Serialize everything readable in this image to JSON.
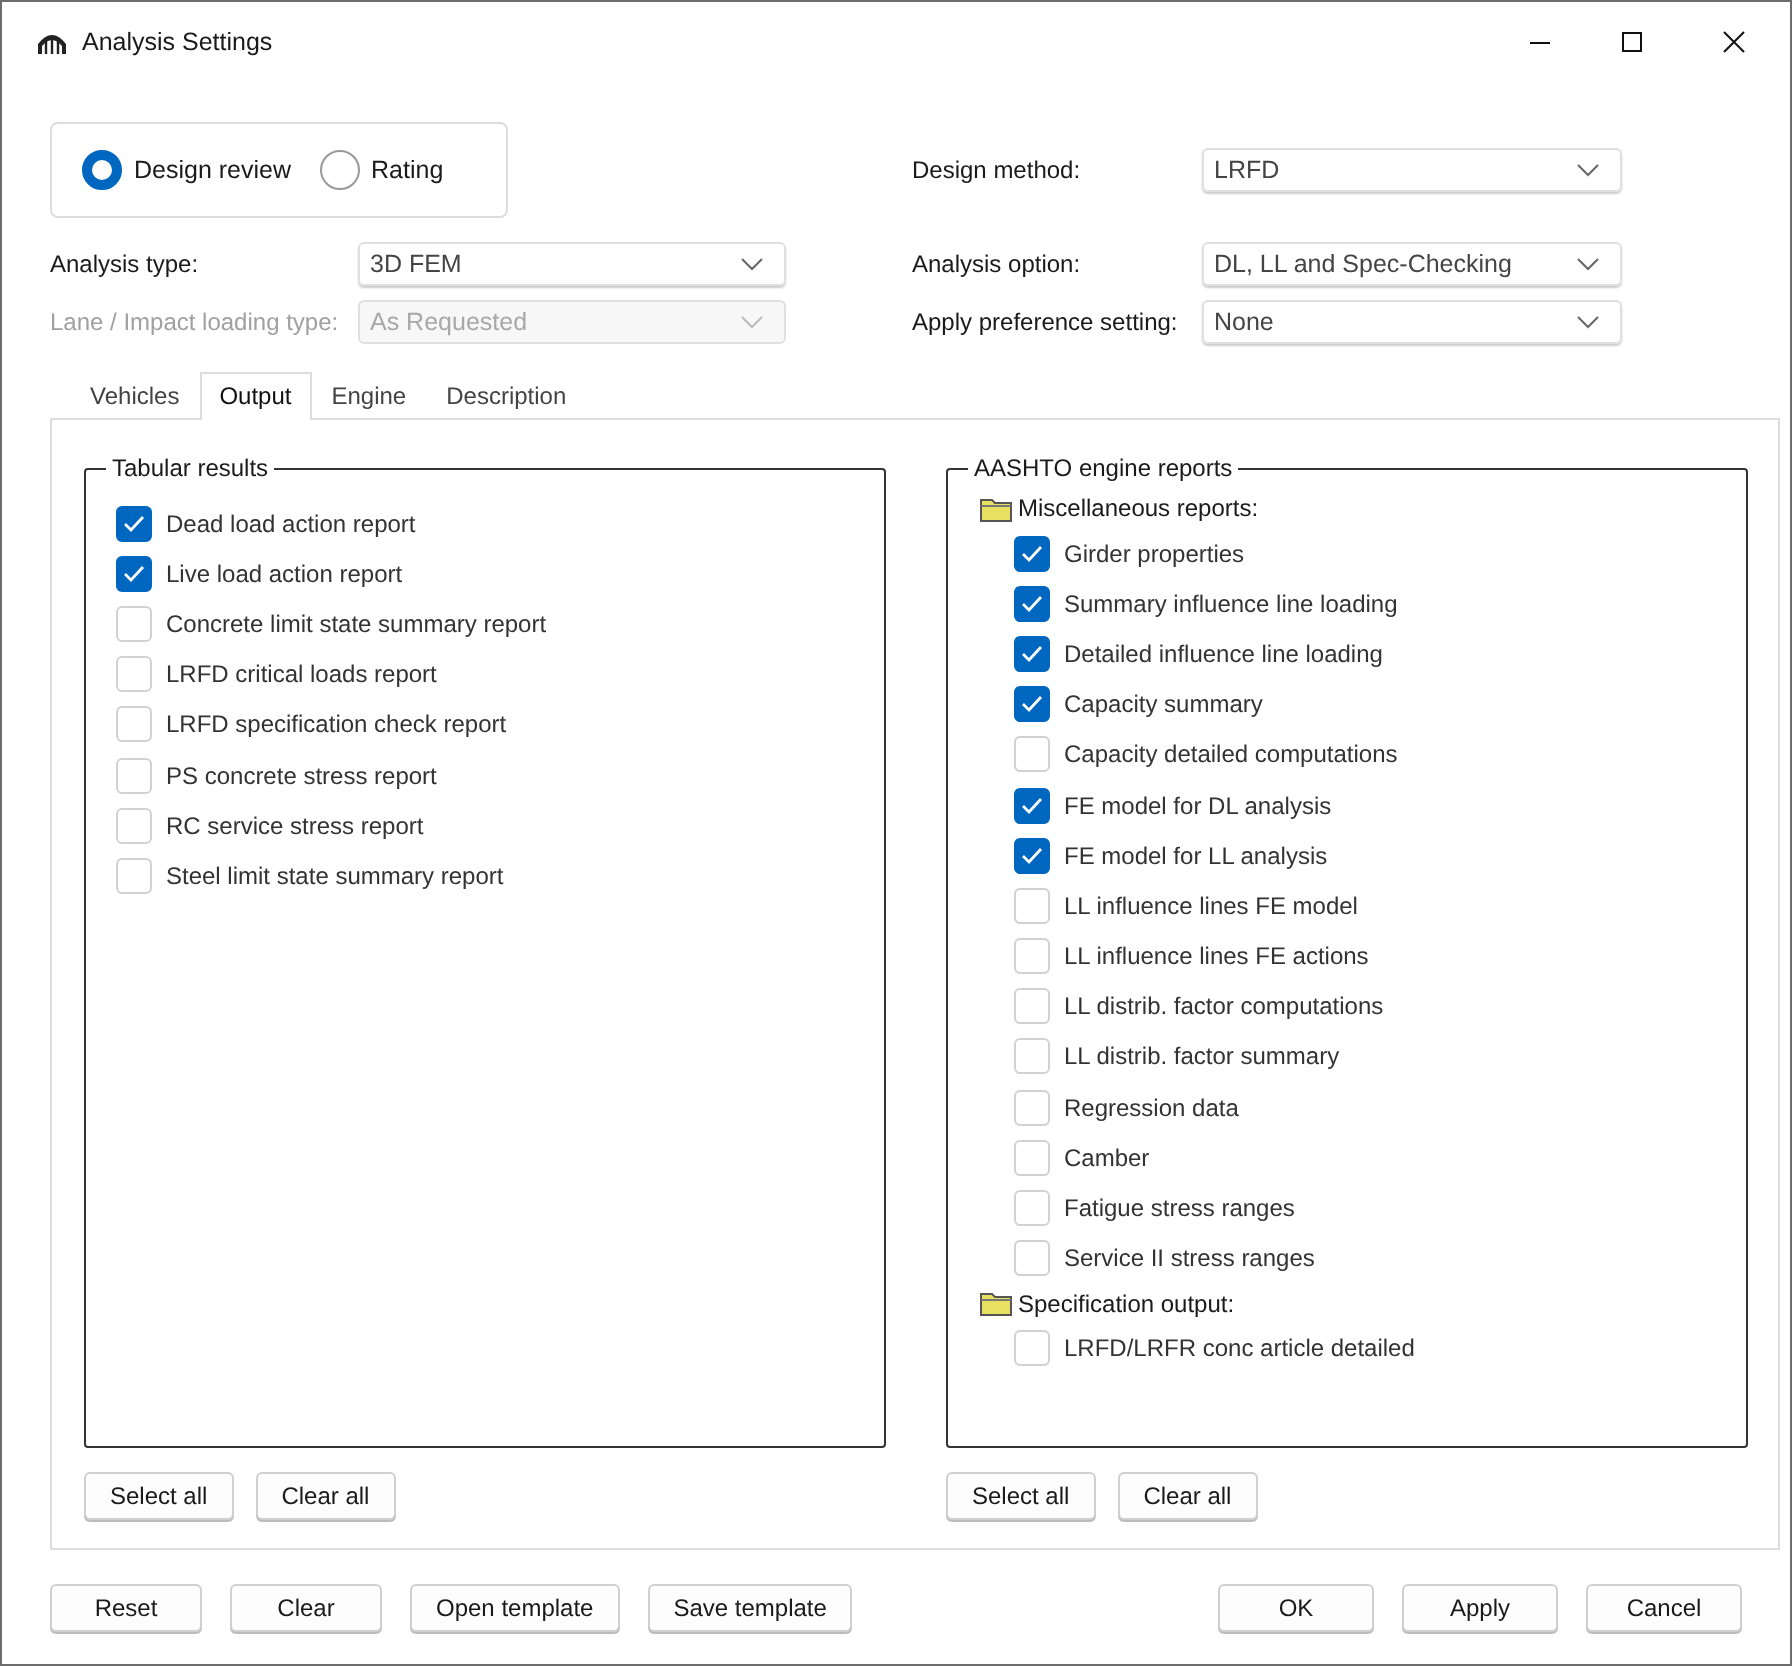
{
  "window": {
    "title": "Analysis Settings"
  },
  "mode": [
    {
      "label": "Design review",
      "selected": true
    },
    {
      "label": "Rating",
      "selected": false
    }
  ],
  "left_fields": [
    {
      "label": "Analysis type:",
      "value": "3D FEM",
      "disabled": false
    },
    {
      "label": "Lane / Impact loading type:",
      "value": "As Requested",
      "disabled": true
    }
  ],
  "design_method": {
    "label": "Design method:",
    "value": "LRFD",
    "disabled": false
  },
  "right_fields": [
    {
      "label": "Analysis option:",
      "value": "DL, LL and Spec-Checking",
      "disabled": false
    },
    {
      "label": "Apply preference setting:",
      "value": "None",
      "disabled": false
    }
  ],
  "tabs": [
    {
      "label": "Vehicles",
      "selected": false
    },
    {
      "label": "Output",
      "selected": true
    },
    {
      "label": "Engine",
      "selected": false
    },
    {
      "label": "Description",
      "selected": false
    }
  ],
  "tabular_results": {
    "title": "Tabular results",
    "items": [
      {
        "label": "Dead load action report",
        "checked": true
      },
      {
        "label": "Live load action report",
        "checked": true
      },
      {
        "label": "Concrete limit state summary report",
        "checked": false
      },
      {
        "label": "LRFD critical loads report",
        "checked": false
      },
      {
        "label": "LRFD specification check report",
        "checked": false
      },
      {
        "label": "PS concrete stress report",
        "checked": false
      },
      {
        "label": "RC service stress report",
        "checked": false
      },
      {
        "label": "Steel limit state summary report",
        "checked": false
      }
    ],
    "buttons": [
      "Select all",
      "Clear all"
    ]
  },
  "engine_reports": {
    "title": "AASHTO engine reports",
    "groups": [
      {
        "label": "Miscellaneous reports:",
        "items": [
          {
            "label": "Girder properties",
            "checked": true
          },
          {
            "label": "Summary influence line loading",
            "checked": true
          },
          {
            "label": "Detailed influence line loading",
            "checked": true
          },
          {
            "label": "Capacity summary",
            "checked": true
          },
          {
            "label": "Capacity detailed computations",
            "checked": false
          },
          {
            "label": "FE model for DL analysis",
            "checked": true
          },
          {
            "label": "FE model for LL analysis",
            "checked": true
          },
          {
            "label": "LL influence lines FE model",
            "checked": false
          },
          {
            "label": "LL influence lines FE actions",
            "checked": false
          },
          {
            "label": "LL distrib. factor computations",
            "checked": false
          },
          {
            "label": "LL distrib. factor summary",
            "checked": false
          },
          {
            "label": "Regression data",
            "checked": false
          },
          {
            "label": "Camber",
            "checked": false
          },
          {
            "label": "Fatigue stress ranges",
            "checked": false
          },
          {
            "label": "Service II stress ranges",
            "checked": false
          }
        ]
      },
      {
        "label": "Specification output:",
        "items": [
          {
            "label": "LRFD/LRFR conc article detailed",
            "checked": false
          }
        ]
      }
    ],
    "buttons": [
      "Select all",
      "Clear all"
    ]
  },
  "footer_left": [
    "Reset",
    "Clear",
    "Open template",
    "Save template"
  ],
  "footer_right": [
    "OK",
    "Apply",
    "Cancel"
  ]
}
